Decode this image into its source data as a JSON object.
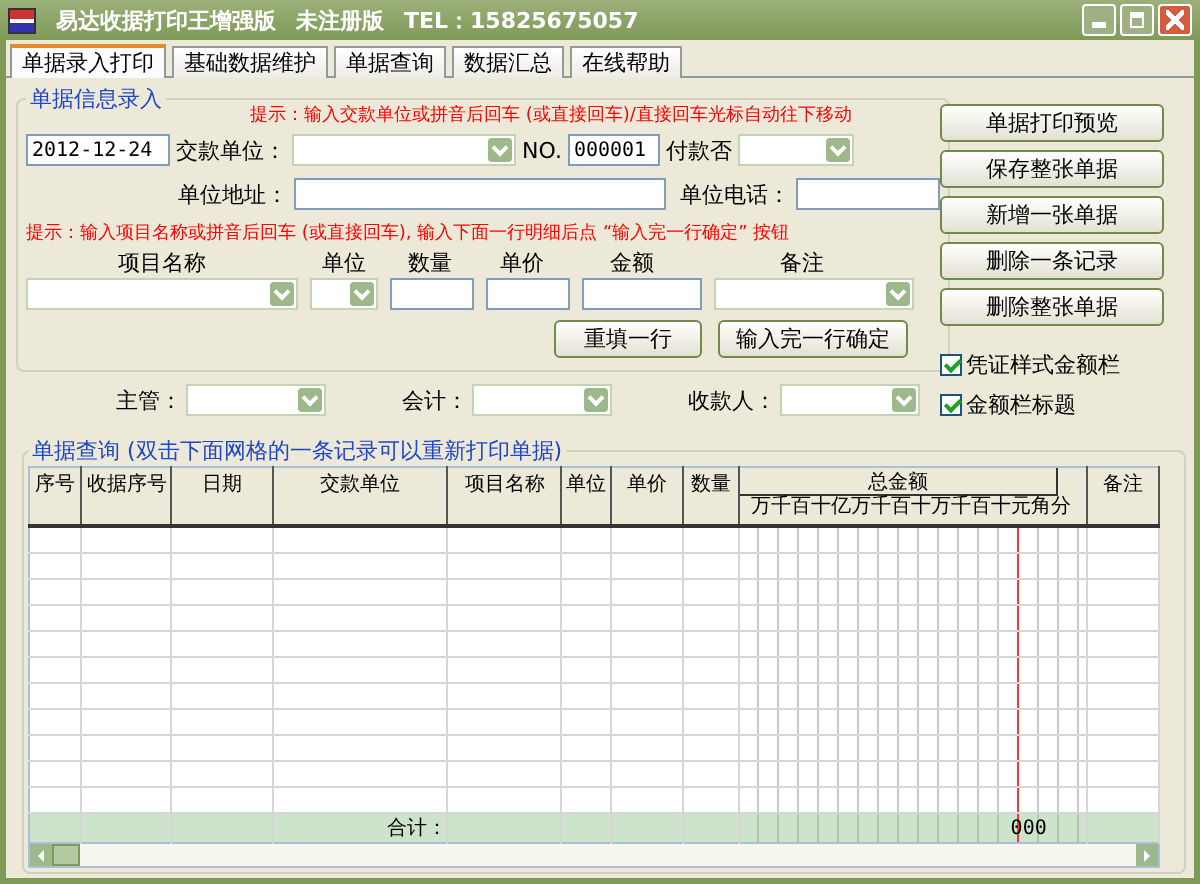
{
  "window": {
    "title": "易达收据打印王增强版",
    "edition": "未注册版",
    "phone": "TEL：15825675057"
  },
  "tabs": [
    {
      "label": "单据录入打印",
      "selected": true
    },
    {
      "label": "基础数据维护",
      "selected": false
    },
    {
      "label": "单据查询",
      "selected": false
    },
    {
      "label": "数据汇总",
      "selected": false
    },
    {
      "label": "在线帮助",
      "selected": false
    }
  ],
  "entry": {
    "title": "单据信息录入",
    "hint_top": "提示：输入交款单位或拼音后回车 (或直接回车)/直接回车光标自动往下移动",
    "date": "2012-12-24",
    "payer_label": "交款单位：",
    "no_label": "NO.",
    "no_value": "000001",
    "paid_label": "付款否",
    "address_label": "单位地址：",
    "phone_label": "单位电话：",
    "hint_items": "提示：输入项目名称或拼音后回车 (或直接回车), 输入下面一行明细后点 “输入完一行确定” 按钮",
    "item_columns": [
      {
        "label": "项目名称",
        "kind": "combo"
      },
      {
        "label": "单位",
        "kind": "combo"
      },
      {
        "label": "数量",
        "kind": "input"
      },
      {
        "label": "单价",
        "kind": "input"
      },
      {
        "label": "金额",
        "kind": "input"
      },
      {
        "label": "备注",
        "kind": "combo"
      }
    ],
    "buttons": [
      "重填一行",
      "输入完一行确定"
    ]
  },
  "signers": [
    "主管：",
    "会计：",
    "收款人："
  ],
  "actions": [
    "单据打印预览",
    "保存整张单据",
    "新增一张单据",
    "删除一条记录",
    "删除整张单据"
  ],
  "options": [
    {
      "label": "凭证样式金额栏",
      "checked": true
    },
    {
      "label": "金额栏标题",
      "checked": true
    }
  ],
  "query": {
    "title": "单据查询 (双击下面网格的一条记录可以重新打印单据)",
    "columns": [
      "序号",
      "收据序号",
      "日期",
      "交款单位",
      "项目名称",
      "单位",
      "单价",
      "数量",
      "总金额",
      "备注"
    ],
    "digit_header": "万千百十亿万千百十万千百十元角分",
    "total_label": "合计：",
    "total_value": "000"
  }
}
